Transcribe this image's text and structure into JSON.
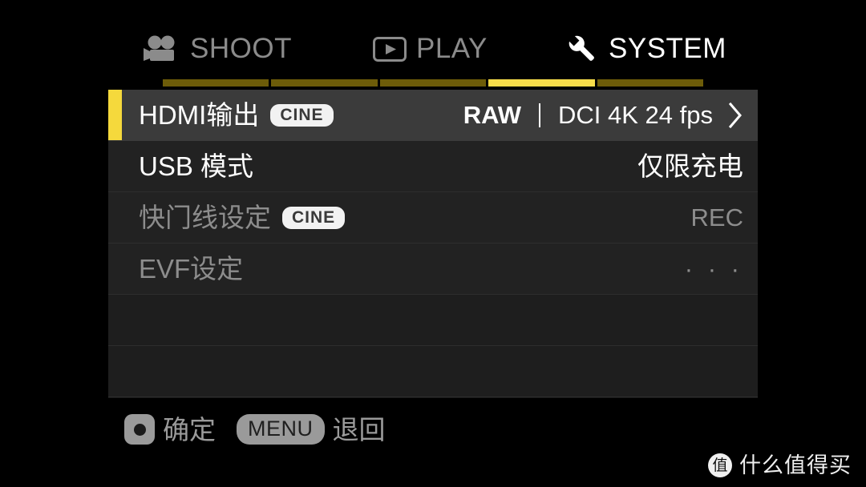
{
  "colors": {
    "background": "#000000",
    "panel_row": "#222222",
    "panel_row_empty": "#1e1e1e",
    "panel_row_selected": "#3b3b3b",
    "selection_bar": "#f5d93c",
    "segment_active": "#f7dc4a",
    "segment_inactive": "#6d5c09",
    "text_primary": "#ffffff",
    "text_dim": "#8d8d8d",
    "tab_inactive": "#8b8b8b",
    "badge_bg": "#f2f2f2",
    "badge_text": "#3a3a3a",
    "footer_text": "#9a9a9a"
  },
  "tabs": [
    {
      "id": "shoot",
      "label": "SHOOT",
      "icon": "movie-camera-icon",
      "active": false
    },
    {
      "id": "play",
      "label": "PLAY",
      "icon": "play-box-icon",
      "active": false
    },
    {
      "id": "system",
      "label": "SYSTEM",
      "icon": "wrench-icon",
      "active": true
    }
  ],
  "page_indicator": {
    "total": 5,
    "active_index": 4
  },
  "menu": {
    "rows": [
      {
        "label": "HDMI输出",
        "badge": "CINE",
        "value_strong": "RAW",
        "value": "DCI 4K 24 fps",
        "separator": true,
        "chevron": true,
        "selected": true,
        "dim": false
      },
      {
        "label": "USB 模式",
        "badge": "",
        "value": "仅限充电",
        "chevron": false,
        "selected": false,
        "dim": false
      },
      {
        "label": "快门线设定",
        "badge": "CINE",
        "value": "REC",
        "chevron": false,
        "selected": false,
        "dim": true
      },
      {
        "label": "EVF设定",
        "badge": "",
        "value": "· · ·",
        "chevron": false,
        "selected": false,
        "dim": true
      },
      {
        "label": "",
        "badge": "",
        "value": "",
        "empty": true
      },
      {
        "label": "",
        "badge": "",
        "value": "",
        "empty": true
      }
    ]
  },
  "footer": {
    "confirm": {
      "icon": "ok-button-icon",
      "label": "确定"
    },
    "back": {
      "button": "MENU",
      "label": "退回"
    }
  },
  "watermark": {
    "logo_char": "值",
    "text": "什么值得买"
  }
}
